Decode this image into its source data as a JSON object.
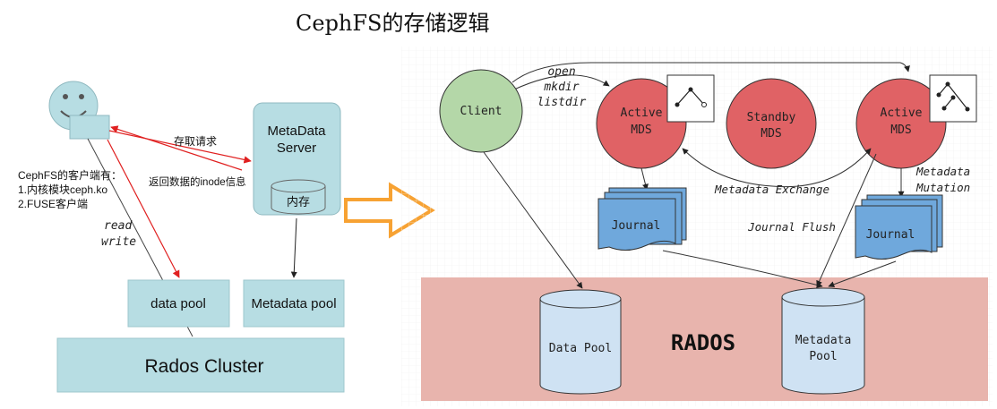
{
  "title": "CephFS的存储逻辑",
  "left": {
    "mds_label_line1": "MetaData",
    "mds_label_line2": "Server",
    "memory_label": "内存",
    "request_label": "存取请求",
    "return_label": "返回数据的inode信息",
    "client_line1": "CephFS的客户端有：",
    "client_line2": "1.内核模块ceph.ko",
    "client_line3": "2.FUSE客户端",
    "read_label": "read",
    "write_label": "write",
    "data_pool": "data pool",
    "metadata_pool": "Metadata pool",
    "cluster": "Rados Cluster"
  },
  "right": {
    "client": "Client",
    "op1": "open",
    "op2": "mkdir",
    "op3": "listdir",
    "active": "Active",
    "mds": "MDS",
    "standby": "Standby",
    "metadata_exchange": "Metadata Exchange",
    "metadata": "Metadata",
    "mutation": "Mutation",
    "journal": "Journal",
    "journal_flush": "Journal Flush",
    "rados": "RADOS",
    "data_pool_line1": "Data Pool",
    "meta_pool_line1": "Metadata",
    "meta_pool_line2": "Pool"
  },
  "colors": {
    "teal": "#b7dde3",
    "client_green": "#b4d7a8",
    "mds_red": "#e06265",
    "journal_blue": "#6fa8dc",
    "rados_band": "#e8b4ad",
    "pool_blue": "#cfe2f3",
    "arrow_orange": "#f7a233",
    "red_line": "#e02020"
  },
  "icons": [
    "smiley-user-icon",
    "tree-icon",
    "orange-arrow-icon"
  ]
}
